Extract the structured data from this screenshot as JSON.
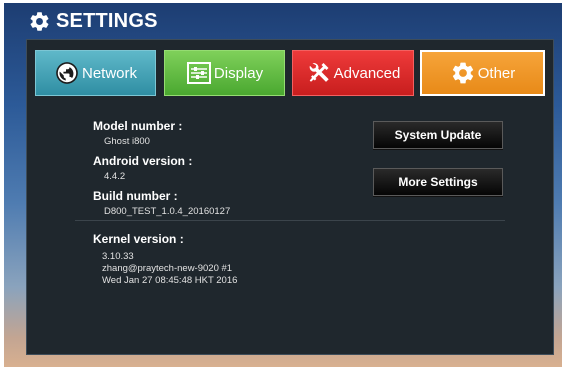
{
  "header": {
    "title": "SETTINGS",
    "icon": "gear-icon"
  },
  "tabs": [
    {
      "label": "Network",
      "icon": "globe-icon",
      "color": "#2f8ea3"
    },
    {
      "label": "Display",
      "icon": "sliders-icon",
      "color": "#4aa830"
    },
    {
      "label": "Advanced",
      "icon": "tools-icon",
      "color": "#c81e1e"
    },
    {
      "label": "Other",
      "icon": "gear-icon",
      "color": "#e88a18",
      "selected": true
    }
  ],
  "info": {
    "model_label": "Model number :",
    "model_value": "Ghost i800",
    "android_label": "Android version :",
    "android_value": "4.4.2",
    "build_label": "Build number :",
    "build_value": "D800_TEST_1.0.4_20160127",
    "kernel_label": "Kernel version :",
    "kernel_lines": [
      "3.10.33",
      "zhang@praytech-new-9020 #1",
      "Wed Jan 27 08:45:48 HKT 2016"
    ]
  },
  "buttons": {
    "system_update": "System Update",
    "more_settings": "More Settings"
  }
}
